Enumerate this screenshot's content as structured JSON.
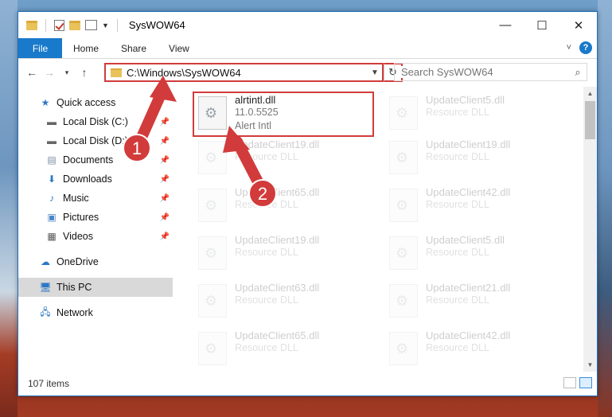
{
  "window": {
    "title": "SysWOW64",
    "controls": {
      "minimize": "—",
      "maximize": "☐",
      "close": "✕"
    }
  },
  "ribbon": {
    "tabs": [
      "File",
      "Home",
      "Share",
      "View"
    ],
    "help": "?"
  },
  "address": {
    "path": "C:\\Windows\\SysWOW64",
    "search_placeholder": "Search SysWOW64"
  },
  "nav": {
    "items": [
      {
        "label": "Quick access",
        "icon": "star-icon",
        "pinned": false
      },
      {
        "label": "Local Disk (C:)",
        "icon": "drive-icon",
        "pinned": true
      },
      {
        "label": "Local Disk (D:)",
        "icon": "drive-icon",
        "pinned": true
      },
      {
        "label": "Documents",
        "icon": "documents-icon",
        "pinned": true
      },
      {
        "label": "Downloads",
        "icon": "download-icon",
        "pinned": true
      },
      {
        "label": "Music",
        "icon": "music-icon",
        "pinned": true
      },
      {
        "label": "Pictures",
        "icon": "pictures-icon",
        "pinned": true
      },
      {
        "label": "Videos",
        "icon": "videos-icon",
        "pinned": true
      },
      {
        "label": "OneDrive",
        "icon": "cloud-icon",
        "pinned": false
      },
      {
        "label": "This PC",
        "icon": "computer-icon",
        "pinned": false,
        "selected": true
      },
      {
        "label": "Network",
        "icon": "network-icon",
        "pinned": false
      }
    ]
  },
  "files": {
    "highlighted": {
      "name": "alrtintl.dll",
      "version": "11.0.5525",
      "description": "Alert Intl"
    },
    "left_column": [
      {
        "name": "UpdateClient19.dll",
        "type": "Resource DLL"
      },
      {
        "name": "UpdateClient65.dll",
        "type": "Resource DLL"
      },
      {
        "name": "UpdateClient19.dll",
        "type": "Resource DLL"
      },
      {
        "name": "UpdateClient63.dll",
        "type": "Resource DLL"
      },
      {
        "name": "UpdateClient65.dll",
        "type": "Resource DLL"
      }
    ],
    "right_column": [
      {
        "name": "UpdateClient5.dll",
        "type": "Resource DLL"
      },
      {
        "name": "UpdateClient19.dll",
        "type": "Resource DLL"
      },
      {
        "name": "UpdateClient42.dll",
        "type": "Resource DLL"
      },
      {
        "name": "UpdateClient5.dll",
        "type": "Resource DLL"
      },
      {
        "name": "UpdateClient21.dll",
        "type": "Resource DLL"
      },
      {
        "name": "UpdateClient42.dll",
        "type": "Resource DLL"
      }
    ]
  },
  "status": {
    "item_count": "107 items"
  },
  "annotations": {
    "callout_1": "1",
    "callout_2": "2",
    "color": "#d23b3b"
  }
}
